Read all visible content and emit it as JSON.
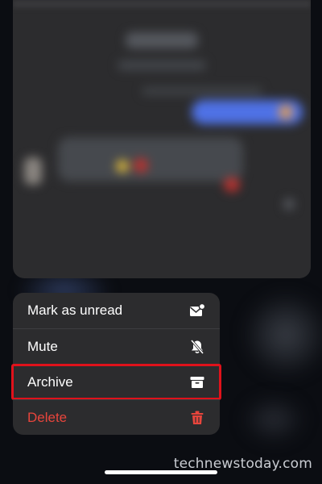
{
  "menu": {
    "items": [
      {
        "label": "Mark as unread",
        "icon": "envelope-badge-icon"
      },
      {
        "label": "Mute",
        "icon": "bell-slash-icon"
      },
      {
        "label": "Archive",
        "icon": "archive-box-icon"
      },
      {
        "label": "Delete",
        "icon": "trash-icon"
      }
    ],
    "highlighted": "Archive",
    "highlight_color": "#e0121b",
    "destructive_color": "#e8453c"
  },
  "watermark": "technewstoday.com"
}
